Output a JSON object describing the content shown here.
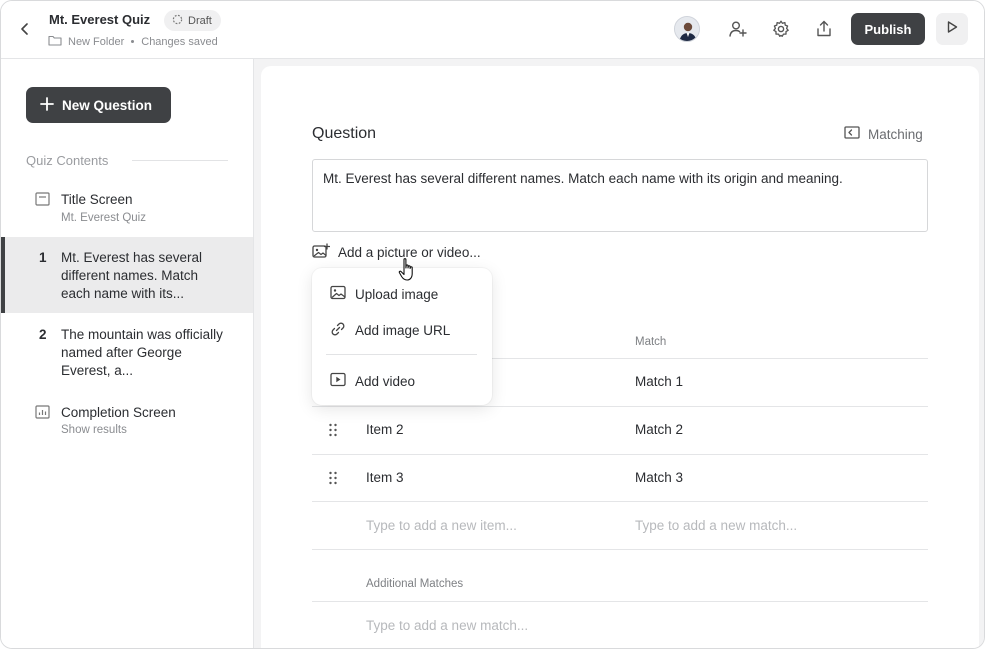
{
  "header": {
    "title": "Mt. Everest Quiz",
    "status_badge": "Draft",
    "folder": "New Folder",
    "save_status": "Changes saved",
    "publish_label": "Publish"
  },
  "sidebar": {
    "new_question_label": "New Question",
    "contents_label": "Quiz Contents",
    "items": [
      {
        "label": "Title Screen",
        "sub": "Mt. Everest Quiz",
        "icon": "title-screen-icon"
      },
      {
        "number": "1",
        "label": "Mt. Everest has several different names. Match each name with its..."
      },
      {
        "number": "2",
        "label": "The mountain was officially named after George Everest, a..."
      },
      {
        "label": "Completion Screen",
        "sub": "Show results",
        "icon": "bar-chart-icon"
      }
    ]
  },
  "editor": {
    "question_label": "Question",
    "question_type": "Matching",
    "question_text": "Mt. Everest has several different names. Match each name with its origin and meaning.",
    "add_media_label": "Add a picture or video...",
    "match_header": "Match",
    "rows": [
      {
        "item": "",
        "match": "Match 1"
      },
      {
        "item": "Item 2",
        "match": "Match 2"
      },
      {
        "item": "Item 3",
        "match": "Match 3"
      }
    ],
    "new_item_placeholder": "Type to add a new item...",
    "new_match_placeholder": "Type to add a new match...",
    "additional_matches_label": "Additional Matches",
    "additional_match_placeholder": "Type to add a new match..."
  },
  "media_menu": {
    "upload_image": "Upload image",
    "add_image_url": "Add image URL",
    "add_video": "Add video"
  },
  "colors": {
    "primary_button": "#3f4144",
    "active_item_bg": "#ebebec",
    "placeholder": "#b7b9bc"
  }
}
